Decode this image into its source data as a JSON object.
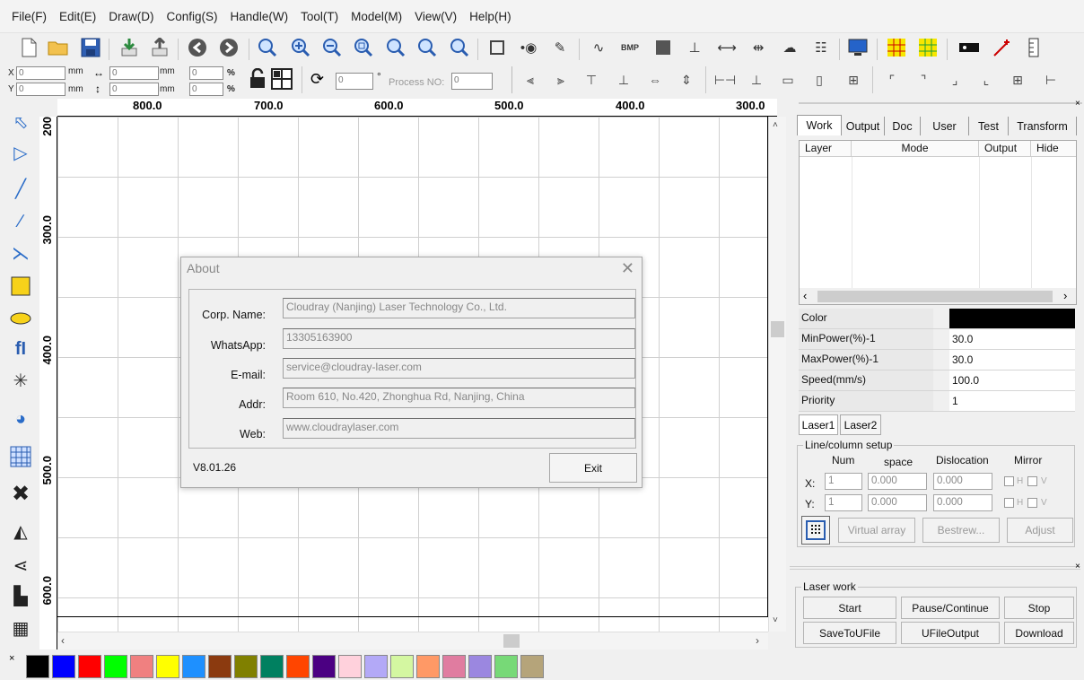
{
  "menu": [
    {
      "label": "File(F)"
    },
    {
      "label": "Edit(E)"
    },
    {
      "label": "Draw(D)"
    },
    {
      "label": "Config(S)"
    },
    {
      "label": "Handle(W)"
    },
    {
      "label": "Tool(T)"
    },
    {
      "label": "Model(M)"
    },
    {
      "label": "View(V)"
    },
    {
      "label": "Help(H)"
    }
  ],
  "position_bar": {
    "x_value": "0",
    "y_value": "0",
    "x_unit": "mm",
    "y_unit": "mm",
    "width_value": "0",
    "height_value": "0",
    "w_unit": "mm",
    "h_unit": "mm",
    "scale_x": "0",
    "scale_y": "0",
    "pct_x": "%",
    "pct_y": "%",
    "rotate_value": "0",
    "degree": "°",
    "process_no_label": "Process NO:",
    "process_no_value": "0",
    "x_axis": "X",
    "y_axis": "Y"
  },
  "ruler_top": [
    "800.0",
    "700.0",
    "600.0",
    "500.0",
    "400.0",
    "300.0"
  ],
  "ruler_left": [
    "200",
    "300.0",
    "400.0",
    "500.0",
    "600.0"
  ],
  "about": {
    "title": "About",
    "corp_label": "Corp. Name:",
    "corp_value": "Cloudray (Nanjing) Laser Technology Co., Ltd.",
    "whatsapp_label": "WhatsApp:",
    "whatsapp_value": "13305163900",
    "email_label": "E-mail:",
    "email_value": "service@cloudray-laser.com",
    "addr_label": "Addr:",
    "addr_value": "Room 610, No.420, Zhonghua Rd, Nanjing, China",
    "web_label": "Web:",
    "web_value": "www.cloudraylaser.com",
    "version": "V8.01.26",
    "exit_label": "Exit"
  },
  "right_panel": {
    "tabs": [
      {
        "label": "Work"
      },
      {
        "label": "Output"
      },
      {
        "label": "Doc"
      },
      {
        "label": "User"
      },
      {
        "label": "Test"
      },
      {
        "label": "Transform"
      }
    ],
    "layer_headers": {
      "layer": "Layer",
      "mode": "Mode",
      "output": "Output",
      "hide": "Hide"
    },
    "props": [
      {
        "name": "Color",
        "value": ""
      },
      {
        "name": "MinPower(%)-1",
        "value": "30.0"
      },
      {
        "name": "MaxPower(%)-1",
        "value": "30.0"
      },
      {
        "name": "Speed(mm/s)",
        "value": "100.0"
      },
      {
        "name": "Priority",
        "value": "1"
      }
    ],
    "color_value": "#000000",
    "laser_tabs": [
      {
        "label": "Laser1"
      },
      {
        "label": "Laser2"
      }
    ],
    "line_column": {
      "title": "Line/column setup",
      "num": "Num",
      "space": "space",
      "dislocation": "Dislocation",
      "mirror": "Mirror",
      "x_label": "X:",
      "y_label": "Y:",
      "x_num": "1",
      "x_space": "0.000",
      "x_disloc": "0.000",
      "y_num": "1",
      "y_space": "0.000",
      "y_disloc": "0.000",
      "h": "H",
      "v": "V"
    },
    "array_buttons": {
      "virtual": "Virtual array",
      "bestrew": "Bestrew...",
      "adjust": "Adjust"
    },
    "laser_work": {
      "title": "Laser work",
      "start": "Start",
      "pause": "Pause/Continue",
      "stop": "Stop",
      "save": "SaveToUFile",
      "ufile": "UFileOutput",
      "download": "Download"
    }
  },
  "palette": [
    "#000000",
    "#0000ff",
    "#ff0000",
    "#00ff00",
    "#f08080",
    "#ffff00",
    "#1e90ff",
    "#8b3a0f",
    "#808000",
    "#008060",
    "#ff4500",
    "#4b0082",
    "#ffd1dc",
    "#b3a9f7",
    "#d4f7a1",
    "#ff9966",
    "#e07ca0",
    "#9b87e0",
    "#77d977",
    "#b5a47a"
  ],
  "close_glyph": "✕"
}
